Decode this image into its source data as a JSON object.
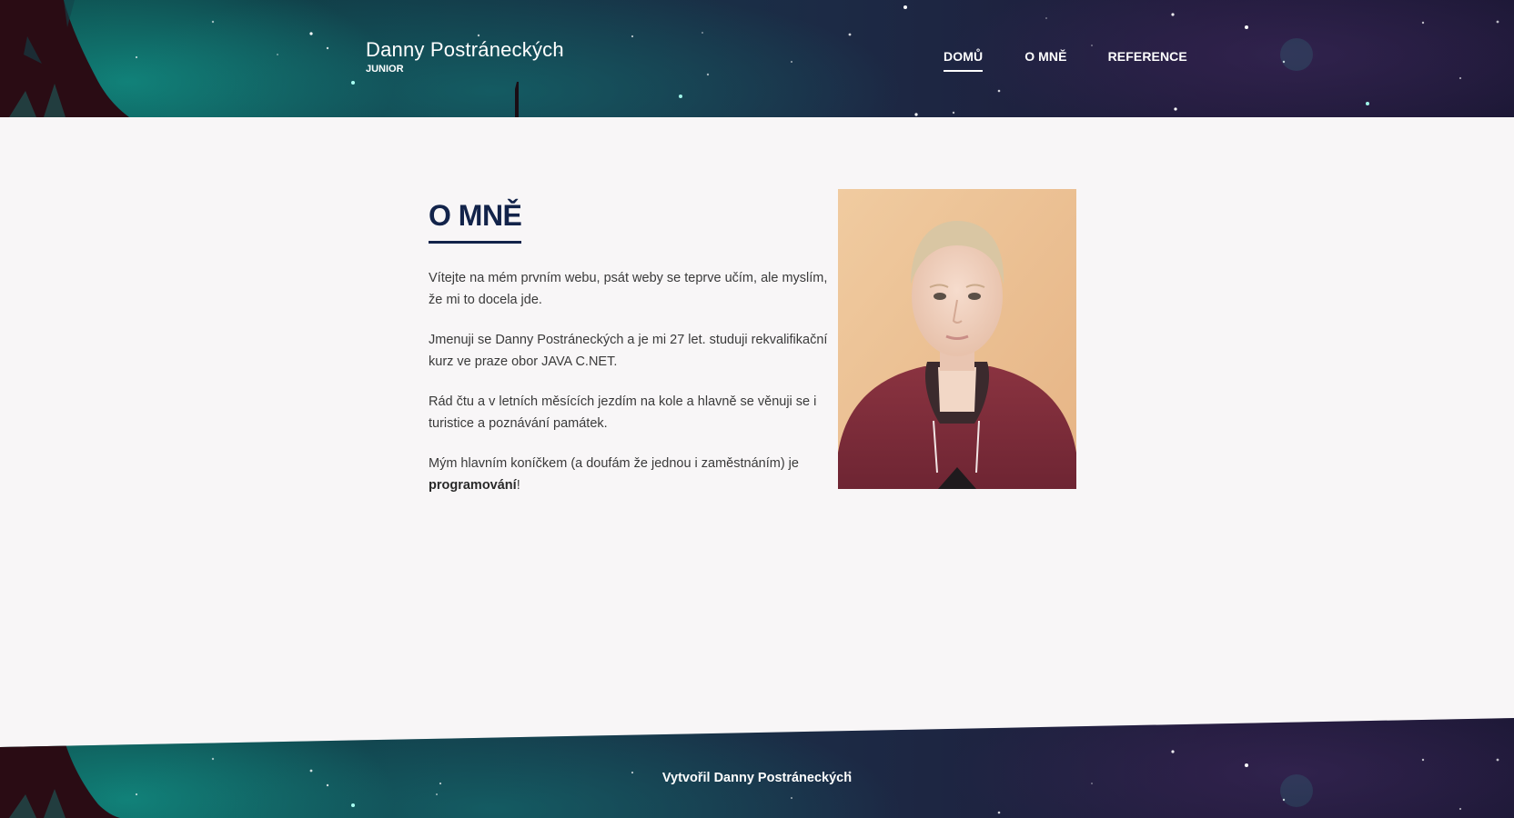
{
  "header": {
    "brand_title": "Danny Postráneckých",
    "brand_subtitle": "JUNIOR"
  },
  "nav": {
    "items": [
      {
        "label": "DOMŮ",
        "active": true
      },
      {
        "label": "O MNĚ",
        "active": false
      },
      {
        "label": "REFERENCE",
        "active": false
      }
    ]
  },
  "about": {
    "title": "O MNĚ",
    "paragraphs": [
      "Vítejte na mém prvním webu, psát weby se teprve učím, ale myslím, že mi to docela jde.",
      "Jmenuji se Danny Postráneckých a je mi 27 let. studuji rekvalifikační kurz ve praze obor JAVA C.NET.",
      "Rád čtu a v letních měsících jezdím na kole a hlavně se věnuji se i turistice a poznávání památek."
    ],
    "last_paragraph_start": "Mým hlavním koníčkem (a doufám že jednou i zaměstnáním) je",
    "last_paragraph_bold": "programování",
    "last_paragraph_end": "!",
    "photo_icon": "portrait-photo"
  },
  "footer": {
    "text": "Vytvořil Danny Postráneckých"
  },
  "colors": {
    "heading": "#12234a",
    "body_text": "#3a3a3a",
    "page_bg": "#f8f6f7",
    "night_teal": "#0d4a4a",
    "night_purple": "#201a3a"
  }
}
